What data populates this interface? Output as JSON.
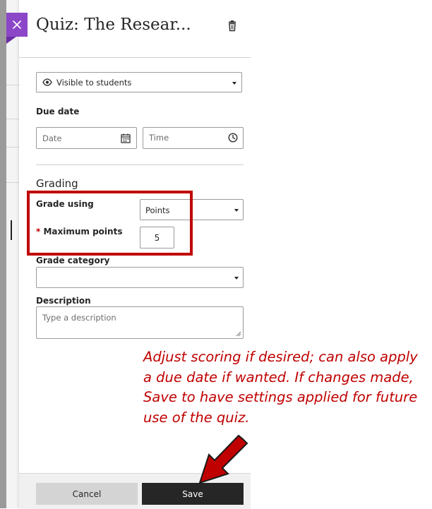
{
  "panel": {
    "title": "Quiz: The Resear...",
    "visibility": {
      "selected": "Visible to students"
    },
    "due_date": {
      "label": "Due date",
      "date_placeholder": "Date",
      "time_placeholder": "Time"
    },
    "grading": {
      "section_title": "Grading",
      "grade_using_label": "Grade using",
      "grade_using_value": "Points",
      "max_points_required": "*",
      "max_points_label": "Maximum points",
      "max_points_value": "5",
      "grade_category_label": "Grade category",
      "grade_category_value": ""
    },
    "description": {
      "label": "Description",
      "placeholder": "Type a description"
    },
    "footer": {
      "cancel_label": "Cancel",
      "save_label": "Save"
    }
  },
  "annotation": {
    "text": "Adjust scoring if desired; can also apply a due date if wanted. If changes made, Save to have settings applied for future use of the quiz.",
    "color": "#c00000"
  },
  "colors": {
    "accent_purple": "#8c47c8",
    "save_button": "#262626",
    "highlight_red": "#c00000"
  },
  "icons": [
    "close-icon",
    "trash-icon",
    "eye-icon",
    "calendar-icon",
    "clock-icon",
    "chevron-down-icon",
    "resize-grip-icon",
    "red-arrow"
  ]
}
